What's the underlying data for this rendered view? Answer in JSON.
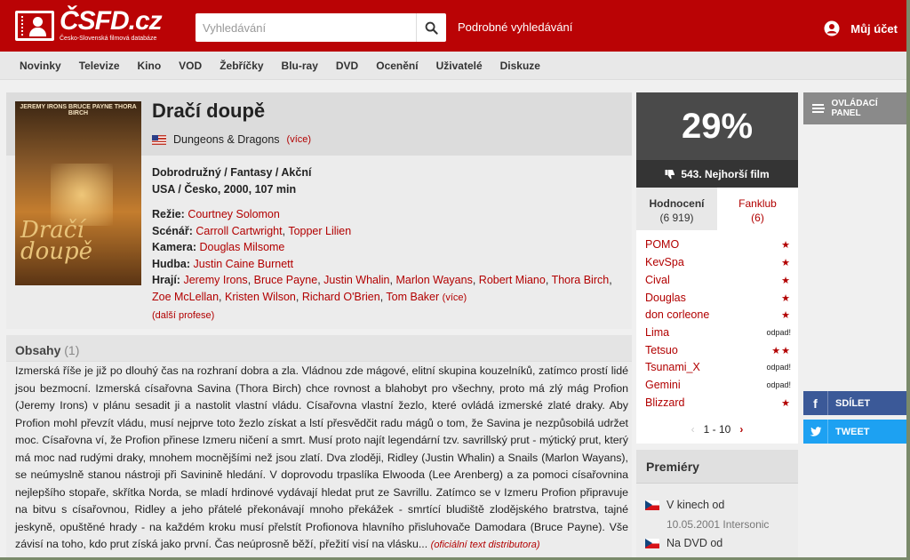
{
  "header": {
    "logo_text": "ČSFD.cz",
    "logo_sub": "Česko-Slovenská filmová databáze",
    "search_placeholder": "Vyhledávání",
    "advanced_search": "Podrobné vyhledávání",
    "account": "Můj účet"
  },
  "nav": [
    "Novinky",
    "Televize",
    "Kino",
    "VOD",
    "Žebříčky",
    "Blu-ray",
    "DVD",
    "Ocenění",
    "Uživatelé",
    "Diskuze"
  ],
  "film": {
    "title": "Dračí doupě",
    "alt_title": "Dungeons & Dragons",
    "alt_more": "(více)",
    "genres": "Dobrodružný / Fantasy / Akční",
    "origin": "USA / Česko, 2000, 107 min",
    "director_label": "Režie:",
    "director": "Courtney Solomon",
    "screenplay_label": "Scénář:",
    "screenplay": [
      "Carroll Cartwright",
      "Topper Lilien"
    ],
    "camera_label": "Kamera:",
    "camera": "Douglas Milsome",
    "music_label": "Hudba:",
    "music": "Justin Caine Burnett",
    "cast_label": "Hrají:",
    "cast": [
      "Jeremy Irons",
      "Bruce Payne",
      "Justin Whalin",
      "Marlon Wayans",
      "Robert Miano",
      "Thora Birch",
      "Zoe McLellan",
      "Kristen Wilson",
      "Richard O'Brien",
      "Tom Baker"
    ],
    "cast_more": "(více)",
    "more_professions": "(další profese)",
    "poster_top": "JEREMY IRONS  BRUCE PAYNE  THORA BIRCH",
    "poster_title": "Dračí doupě"
  },
  "plot": {
    "title": "Obsahy",
    "count": "(1)",
    "text": "Izmerská říše je již po dlouhý čas na rozhraní dobra a zla. Vládnou zde mágové, elitní skupina kouzelníků, zatímco prostí lidé jsou bezmocní. Izmerská císařovna Savina (Thora Birch) chce rovnost a blahobyt pro všechny, proto má zlý mág Profion (Jeremy Irons) v plánu sesadit ji a nastolit vlastní vládu. Císařovna vlastní žezlo, které ovládá izmerské zlaté draky. Aby Profion mohl převzít vládu, musí nejprve toto žezlo získat a lstí přesvědčit radu mágů o tom, že Savina je nezpůsobilá udržet moc. Císařovna ví, že Profion přinese Izmeru ničení a smrt. Musí proto najít legendární tzv. savrillský prut - mýtický prut, který má moc nad rudými draky, mnohem mocnějšími než jsou zlatí. Dva zloději, Ridley (Justin Whalin) a Snails (Marlon Wayans), se neúmyslně stanou nástroji při Savinině hledání. V doprovodu trpaslíka Elwooda (Lee Arenberg) a za pomoci císařovnina nejlepšího stopaře, skřítka Norda, se mladí hrdinové vydávají hledat prut ze Savrillu. Zatímco se v Izmeru Profion připravuje na bitvu s císařovnou, Ridley a jeho přátelé překonávají mnoho překážek - smrtící bludiště zlodějského bratrstva, tajné jeskyně, opuštěné hrady - na každém kroku musí přelstít Profionova hlavního přisluhovače Damodara (Bruce Payne). Vše závisí na toho, kdo prut získá jako první. Čas neúprosně běží, přežití visí na vlásku...",
    "source": "(oficiální text distributora)"
  },
  "rating": {
    "percent": "29%",
    "rank": "543. Nejhorší film",
    "tab_ratings": "Hodnocení",
    "tab_ratings_count": "(6 919)",
    "tab_fanclub": "Fanklub",
    "tab_fanclub_count": "(6)",
    "users": [
      {
        "name": "POMO",
        "score": "★"
      },
      {
        "name": "KevSpa",
        "score": "★"
      },
      {
        "name": "Cival",
        "score": "★"
      },
      {
        "name": "Douglas",
        "score": "★"
      },
      {
        "name": "don corleone",
        "score": "★"
      },
      {
        "name": "Lima",
        "score": "odpad!"
      },
      {
        "name": "Tetsuo",
        "score": "★★"
      },
      {
        "name": "Tsunami_X",
        "score": "odpad!"
      },
      {
        "name": "Gemini",
        "score": "odpad!"
      },
      {
        "name": "Blizzard",
        "score": "★"
      }
    ],
    "pager": "1 - 10"
  },
  "premieres": {
    "title": "Premiéry",
    "rows": [
      {
        "label": "V kinech od",
        "date": "10.05.2001 Intersonic"
      },
      {
        "label": "Na DVD od",
        "date": ""
      }
    ]
  },
  "side": {
    "panel": "OVLÁDACÍ PANEL",
    "share_fb": "SDÍLET",
    "share_tw": "TWEET"
  },
  "colors": {
    "brand_red": "#ba0305",
    "link_red": "#b20000",
    "facebook": "#3b5998",
    "twitter": "#1da1f2"
  }
}
